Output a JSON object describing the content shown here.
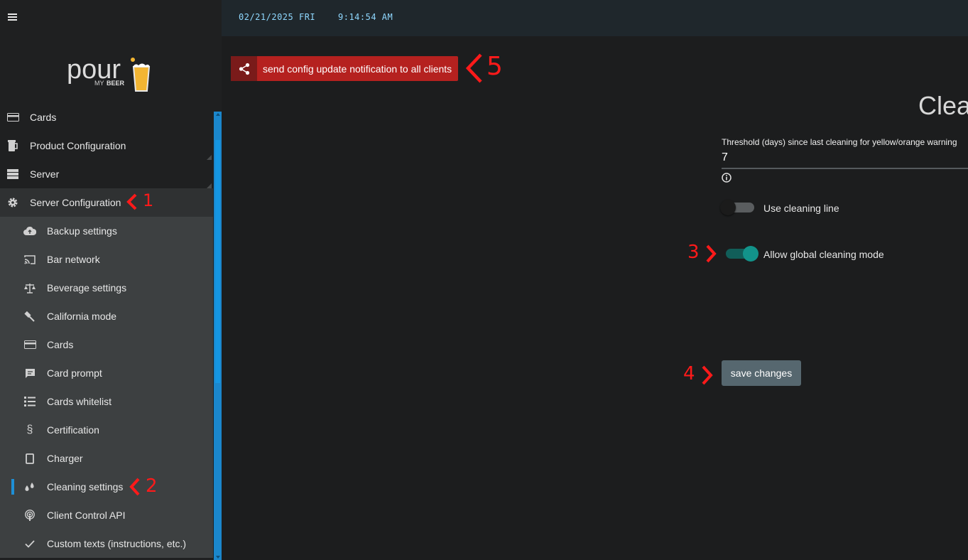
{
  "topbar": {
    "date": "02/21/2025 FRI",
    "time": "9:14:54 AM"
  },
  "logo": {
    "wordmark": "pour",
    "subtitle_my": "MY",
    "subtitle_beer": "BEER"
  },
  "nav": {
    "top_items": [
      {
        "label": "Cards",
        "icon": "credit-card-icon"
      },
      {
        "label": "Product Configuration",
        "icon": "beer-keg-icon"
      },
      {
        "label": "Server",
        "icon": "server-icon"
      },
      {
        "label": "Server Configuration",
        "icon": "gear-icon"
      }
    ],
    "sub_items": [
      {
        "label": "Backup settings",
        "icon": "cloud-backup-icon"
      },
      {
        "label": "Bar network",
        "icon": "cast-icon"
      },
      {
        "label": "Beverage settings",
        "icon": "scale-icon"
      },
      {
        "label": "California mode",
        "icon": "gavel-icon"
      },
      {
        "label": "Cards",
        "icon": "credit-card-icon"
      },
      {
        "label": "Card prompt",
        "icon": "message-icon"
      },
      {
        "label": "Cards whitelist",
        "icon": "list-icon"
      },
      {
        "label": "Certification",
        "icon": "section-icon"
      },
      {
        "label": "Charger",
        "icon": "tablet-icon"
      },
      {
        "label": "Cleaning settings",
        "icon": "droplets-icon"
      },
      {
        "label": "Client Control API",
        "icon": "podcast-icon"
      },
      {
        "label": "Custom texts (instructions, etc.)",
        "icon": "check-icon"
      }
    ]
  },
  "notify_button": {
    "label": "send config update notification to all clients",
    "icon": "share-icon"
  },
  "content": {
    "title": "Clea",
    "threshold": {
      "label": "Threshold (days) since last cleaning for yellow/orange warning",
      "value": "7"
    },
    "use_cleaning_line": {
      "label": "Use cleaning line",
      "checked": false
    },
    "allow_global_cleaning": {
      "label": "Allow global cleaning mode",
      "checked": true
    },
    "save_label": "save changes"
  },
  "annotations": [
    "1",
    "2",
    "3",
    "4",
    "5"
  ],
  "colors": {
    "accent_red": "#b5211f",
    "toggle_on": "#12938a",
    "scrollbar": "#1b87cc",
    "annotation": "#ff1a1a"
  }
}
